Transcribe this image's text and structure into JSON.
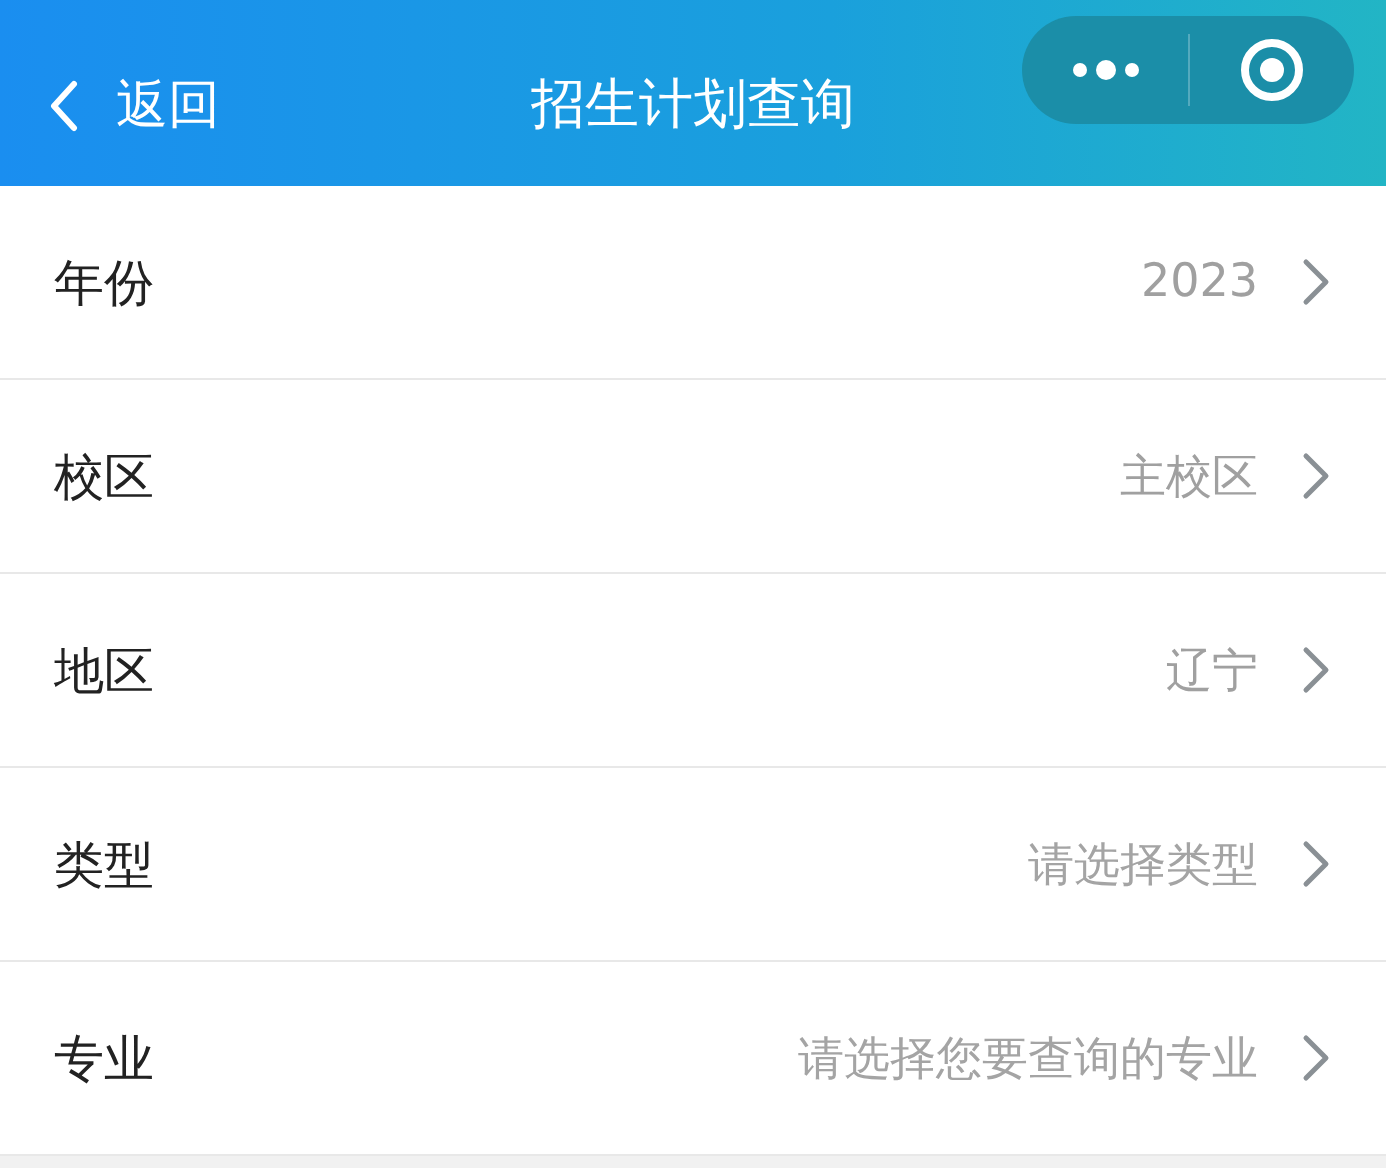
{
  "nav": {
    "back": "返回",
    "title": "招生计划查询"
  },
  "rows": [
    {
      "label": "年份",
      "value": "2023"
    },
    {
      "label": "校区",
      "value": "主校区"
    },
    {
      "label": "地区",
      "value": "辽宁"
    },
    {
      "label": "类型",
      "placeholder": "请选择类型"
    },
    {
      "label": "专业",
      "placeholder": "请选择您要查询的专业"
    }
  ]
}
